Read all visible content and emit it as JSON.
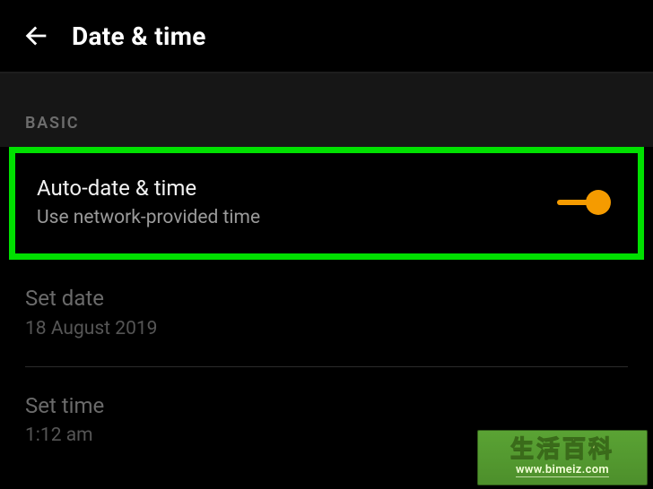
{
  "header": {
    "title": "Date & time"
  },
  "section": {
    "label": "BASIC"
  },
  "rows": {
    "auto": {
      "title": "Auto-date & time",
      "subtitle": "Use network-provided time",
      "toggle_on": true
    },
    "set_date": {
      "title": "Set date",
      "value": "18 August 2019"
    },
    "set_time": {
      "title": "Set time",
      "value": "1:12 am"
    }
  },
  "watermark": {
    "line1": "生活百科",
    "line2": "www.bimeiz.com"
  }
}
